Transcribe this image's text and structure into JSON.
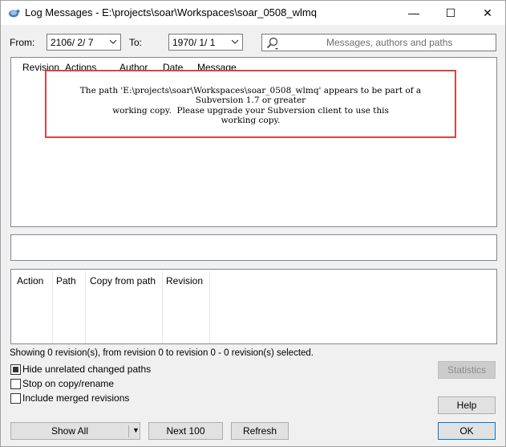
{
  "window": {
    "title": "Log Messages - E:\\projects\\soar\\Workspaces\\soar_0508_wlmq",
    "minimize_glyph": "—",
    "maximize_glyph": "☐",
    "close_glyph": "✕"
  },
  "filters": {
    "from_label": "From:",
    "from_value": "2106/ 2/ 7",
    "to_label": "To:",
    "to_value": "1970/ 1/ 1",
    "search_placeholder": "Messages, authors and paths"
  },
  "log_table": {
    "columns": [
      "Revision",
      "Actions",
      "Author",
      "Date",
      "Message"
    ]
  },
  "error_message": "The path 'E:\\projects\\soar\\Workspaces\\soar_0508_wlmq' appears to be part of a\nSubversion 1.7 or greater\nworking copy.  Please upgrade your Subversion client to use this\nworking copy.",
  "paths_table": {
    "columns": [
      "Action",
      "Path",
      "Copy from path",
      "Revision"
    ]
  },
  "status_text": "Showing 0 revision(s), from revision 0 to revision 0 - 0 revision(s) selected.",
  "options": {
    "hide_unrelated": {
      "label": "Hide unrelated changed paths",
      "checked": true
    },
    "stop_on_copy": {
      "label": "Stop on copy/rename",
      "checked": false
    },
    "include_merged": {
      "label": "Include merged revisions",
      "checked": false
    }
  },
  "buttons": {
    "statistics": "Statistics",
    "help": "Help",
    "show_all": "Show All",
    "next_100": "Next 100",
    "refresh": "Refresh",
    "ok": "OK"
  },
  "colors": {
    "highlight_border": "#d64545",
    "default_button_border": "#0078d7"
  },
  "icons": {
    "app": "tortoise-svn-icon",
    "search": "magnifier-icon",
    "dropdown": "chevron-down-icon"
  }
}
